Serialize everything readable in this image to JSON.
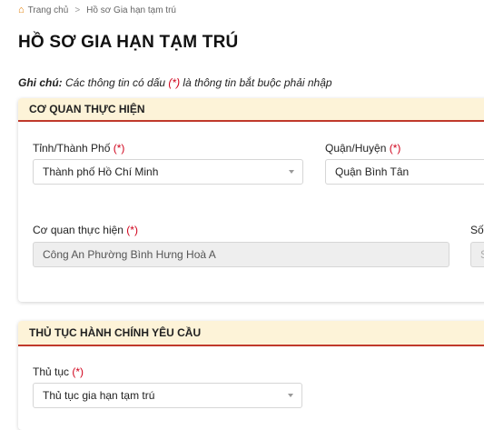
{
  "breadcrumb": {
    "home_label": "Trang chủ",
    "separator": ">",
    "current": "Hồ sơ Gia hạn tạm trú"
  },
  "page_title": "HỒ SƠ GIA HẠN TẠM TRÚ",
  "note": {
    "label": "Ghi chú:",
    "text_before": " Các thông tin có dấu ",
    "marker": "(*)",
    "text_after": " là thông tin bắt buộc phải nhập"
  },
  "agency_section": {
    "header": "CƠ QUAN THỰC HIỆN",
    "province": {
      "label": "Tỉnh/Thành Phố ",
      "required": "(*)",
      "value": "Thành phố Hồ Chí Minh"
    },
    "district": {
      "label": "Quận/Huyện ",
      "required": "(*)",
      "value": "Quận Bình Tân"
    },
    "agency": {
      "label": "Cơ quan thực hiện ",
      "required": "(*)",
      "value": "Công An Phường Bình Hưng Hoà A"
    },
    "extra": {
      "label": "Số",
      "value": "S"
    }
  },
  "procedure_section": {
    "header": "THỦ TỤC HÀNH CHÍNH YÊU CẦU",
    "procedure": {
      "label": "Thủ tục ",
      "required": "(*)",
      "value": "Thủ tục gia hạn tạm trú"
    }
  },
  "colors": {
    "accent_red": "#c0392b",
    "header_bg": "#fdf3d8",
    "required_red": "#d0021b",
    "home_icon": "#e07b00"
  }
}
